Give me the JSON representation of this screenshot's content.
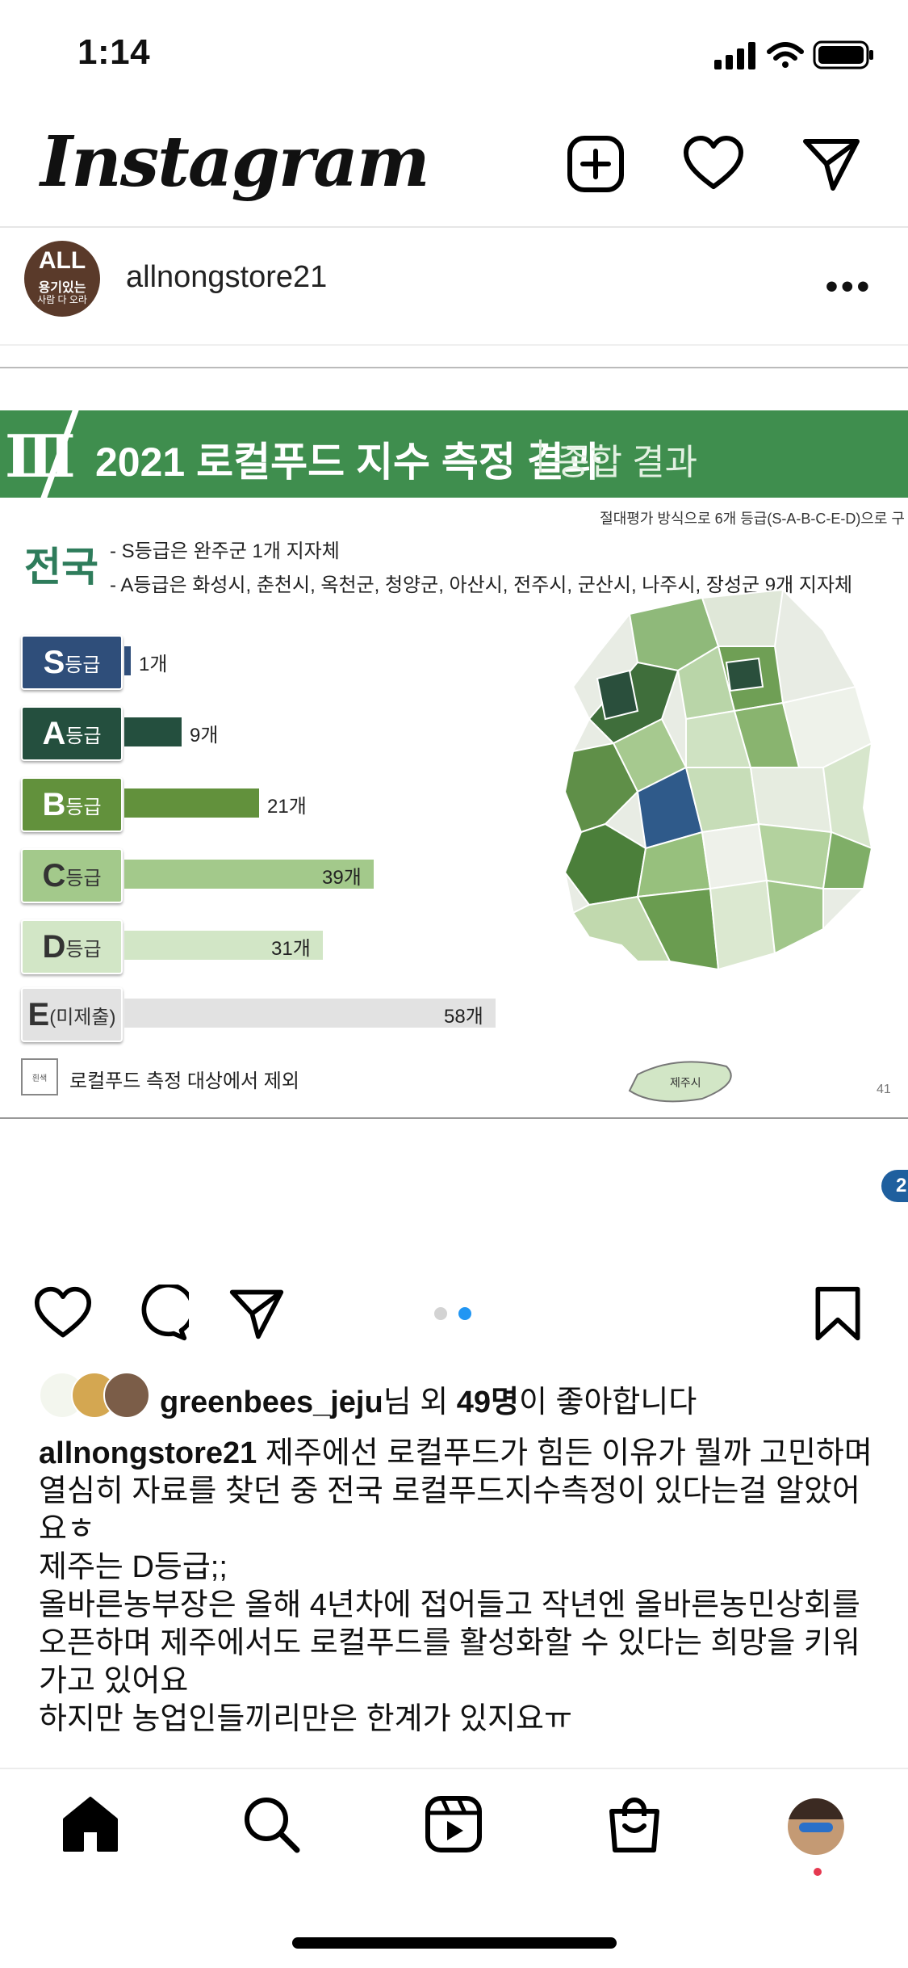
{
  "status_bar": {
    "time": "1:14"
  },
  "header": {
    "logo": "Instagram",
    "icons": [
      "new-post-icon",
      "heart-icon",
      "direct-message-icon"
    ]
  },
  "post": {
    "avatar": {
      "line1": "ALL",
      "line2": "용기있는",
      "line3": "사람 다 오라"
    },
    "username": "allnongstore21",
    "more_icon": "more-horizontal-icon",
    "slide": {
      "roman": "Ⅲ",
      "title": "2021 로컬푸드 지수 측정 결과",
      "subtitle": "종합 결과",
      "note": "절대평가 방식으로 6개 등급(S-A-B-C-E-D)으로 구",
      "nation": "전국",
      "line1": "- S등급은 완주군 1개 지자체",
      "line2": "- A등급은  화성시, 춘천시, 옥천군, 청양군, 아산시, 전주시, 군산시, 나주시, 장성군 9개 지자체",
      "legend_mark": "흰색",
      "legend_text": "로컬푸드 측정 대상에서 제외",
      "page_number": "41",
      "map_label": "제주시"
    },
    "counter_pill": "2",
    "carousel": {
      "count": 2,
      "active": 2
    },
    "likes": {
      "user": "greenbees_jeju",
      "mid": "님 외 ",
      "count": "49명",
      "suffix": "이 좋아합니다"
    },
    "caption": {
      "author": "allnongstore21",
      "text1": " 제주에선 로컬푸드가 힘든 이유가 뭘까 고민하며 열심히 자료를 찾던 중 전국 로컬푸드지수측정이 있다는걸 알았어요ㅎ",
      "text2": "제주는 D등급;;",
      "text3": "올바른농부장은 올해 4년차에 접어들고 작년엔 올바른농민상회를 오픈하며 제주에서도 로컬푸드를 활성화할 수 있다는 희망을 키워가고 있어요",
      "text4": "하지만 농업인들끼리만은 한계가 있지요ㅠ"
    }
  },
  "chart_data": {
    "type": "bar",
    "orientation": "horizontal",
    "categories": [
      "S등급",
      "A등급",
      "B등급",
      "C등급",
      "D등급",
      "E(미제출)"
    ],
    "category_parts": [
      [
        "S",
        "등급"
      ],
      [
        "A",
        "등급"
      ],
      [
        "B",
        "등급"
      ],
      [
        "C",
        "등급"
      ],
      [
        "D",
        "등급"
      ],
      [
        "E",
        "(미제출)"
      ]
    ],
    "values": [
      1,
      9,
      21,
      39,
      31,
      58
    ],
    "value_labels": [
      "1개",
      "9개",
      "21개",
      "39개",
      "31개",
      "58개"
    ],
    "colors": [
      "#2f4e7a",
      "#244f3e",
      "#62913c",
      "#a3c98b",
      "#d2e6c6",
      "#e2e2e2"
    ],
    "xlim": [
      0,
      58
    ]
  },
  "tab_bar": {
    "tabs": [
      "home-icon",
      "search-icon",
      "reels-icon",
      "shop-icon",
      "profile-avatar"
    ]
  }
}
